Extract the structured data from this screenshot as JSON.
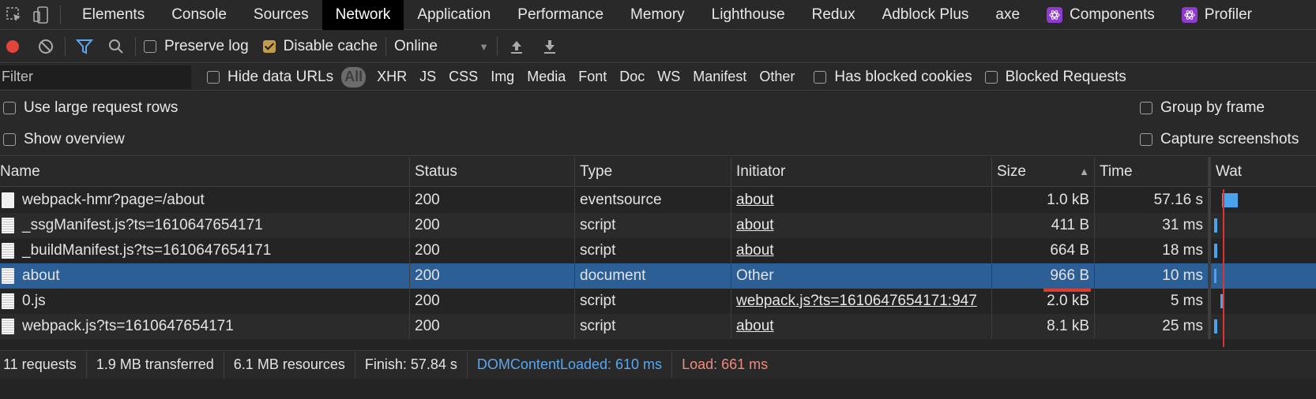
{
  "tabs": [
    "Elements",
    "Console",
    "Sources",
    "Network",
    "Application",
    "Performance",
    "Memory",
    "Lighthouse",
    "Redux",
    "Adblock Plus",
    "axe",
    "Components",
    "Profiler"
  ],
  "active_tab": "Network",
  "toolbar": {
    "preserve_log": "Preserve log",
    "disable_cache": "Disable cache",
    "throttle": "Online"
  },
  "filterbar": {
    "placeholder": "Filter",
    "hide_data_urls": "Hide data URLs",
    "types": [
      "All",
      "XHR",
      "JS",
      "CSS",
      "Img",
      "Media",
      "Font",
      "Doc",
      "WS",
      "Manifest",
      "Other"
    ],
    "has_blocked_cookies": "Has blocked cookies",
    "blocked_requests": "Blocked Requests"
  },
  "options": {
    "large_rows": "Use large request rows",
    "show_overview": "Show overview",
    "group_by_frame": "Group by frame",
    "capture_screenshots": "Capture screenshots"
  },
  "columns": {
    "name": "Name",
    "status": "Status",
    "type": "Type",
    "initiator": "Initiator",
    "size": "Size",
    "time": "Time",
    "waterfall": "Wat"
  },
  "rows": [
    {
      "name": "webpack-hmr?page=/about",
      "status": "200",
      "type": "eventsource",
      "initiator": "about",
      "size": "1.0 kB",
      "time": "57.16 s"
    },
    {
      "name": "_ssgManifest.js?ts=1610647654171",
      "status": "200",
      "type": "script",
      "initiator": "about",
      "size": "411 B",
      "time": "31 ms"
    },
    {
      "name": "_buildManifest.js?ts=1610647654171",
      "status": "200",
      "type": "script",
      "initiator": "about",
      "size": "664 B",
      "time": "18 ms"
    },
    {
      "name": "about",
      "status": "200",
      "type": "document",
      "initiator": "Other",
      "size": "966 B",
      "time": "10 ms"
    },
    {
      "name": "0.js",
      "status": "200",
      "type": "script",
      "initiator": "webpack.js?ts=1610647654171:947",
      "size": "2.0 kB",
      "time": "5 ms"
    },
    {
      "name": "webpack.js?ts=1610647654171",
      "status": "200",
      "type": "script",
      "initiator": "about",
      "size": "8.1 kB",
      "time": "25 ms"
    }
  ],
  "status_bar": {
    "requests": "11 requests",
    "transferred": "1.9 MB transferred",
    "resources": "6.1 MB resources",
    "finish": "Finish: 57.84 s",
    "dcl": "DOMContentLoaded: 610 ms",
    "load": "Load: 661 ms"
  },
  "colors": {
    "accent_selected": "#2c5f96",
    "record": "#e0443a",
    "dcl": "#5aa7ef",
    "load": "#f08a80"
  }
}
